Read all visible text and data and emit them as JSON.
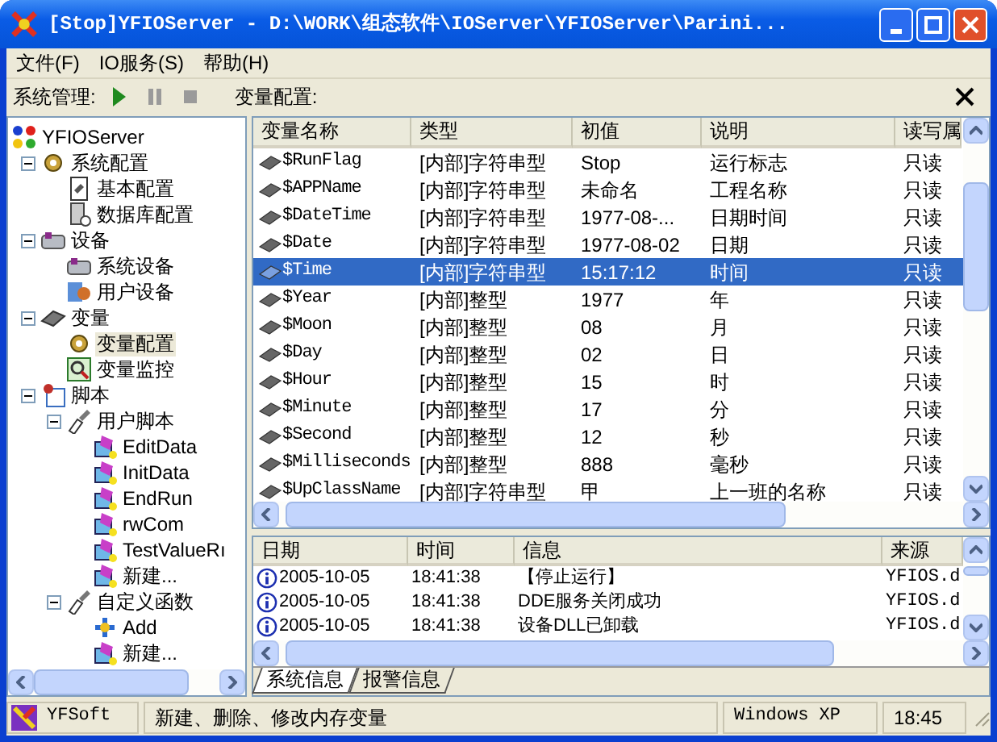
{
  "window": {
    "title": "[Stop]YFIOServer - D:\\WORK\\组态软件\\IOServer\\YFIOServer\\Parini..."
  },
  "menu": [
    "文件(F)",
    "IO服务(S)",
    "帮助(H)"
  ],
  "toolbar": {
    "label": "系统管理:",
    "buttons": [
      {
        "kind": "play",
        "disabled": false
      },
      {
        "kind": "pause",
        "disabled": true
      },
      {
        "kind": "stop",
        "disabled": true
      }
    ]
  },
  "panel_title": "变量配置:",
  "tree": {
    "label": "YFIOServer",
    "selected": false,
    "children": [
      {
        "label": "系统配置",
        "selected": false,
        "expanded": true,
        "children": [
          {
            "label": "基本配置",
            "selected": false
          },
          {
            "label": "数据库配置",
            "selected": false
          }
        ]
      },
      {
        "label": "设备",
        "selected": false,
        "expanded": true,
        "children": [
          {
            "label": "系统设备",
            "selected": false
          },
          {
            "label": "用户设备",
            "selected": false
          }
        ]
      },
      {
        "label": "变量",
        "selected": false,
        "expanded": true,
        "children": [
          {
            "label": "变量配置",
            "selected": true
          },
          {
            "label": "变量监控",
            "selected": false
          }
        ]
      },
      {
        "label": "脚本",
        "selected": false,
        "expanded": true,
        "children": [
          {
            "label": "用户脚本",
            "selected": false,
            "expanded": true,
            "children": [
              {
                "label": "EditData",
                "selected": false
              },
              {
                "label": "InitData",
                "selected": false
              },
              {
                "label": "EndRun",
                "selected": false
              },
              {
                "label": "rwCom",
                "selected": false
              },
              {
                "label": "TestValueRı",
                "selected": false
              },
              {
                "label": "新建...",
                "selected": false
              }
            ]
          },
          {
            "label": "自定义函数",
            "selected": false,
            "expanded": true,
            "children": [
              {
                "label": "Add",
                "selected": false
              },
              {
                "label": "新建...",
                "selected": false
              }
            ]
          }
        ]
      }
    ]
  },
  "table": {
    "columns": [
      "变量名称",
      "类型",
      "初值",
      "说明",
      "读写属"
    ],
    "rows": [
      {
        "cells": [
          "$RunFlag",
          "[内部]字符串型",
          "Stop",
          "运行标志",
          "只读"
        ],
        "selected": false
      },
      {
        "cells": [
          "$APPName",
          "[内部]字符串型",
          "未命名",
          "工程名称",
          "只读"
        ],
        "selected": false
      },
      {
        "cells": [
          "$DateTime",
          "[内部]字符串型",
          "1977-08-...",
          "日期时间",
          "只读"
        ],
        "selected": false
      },
      {
        "cells": [
          "$Date",
          "[内部]字符串型",
          "1977-08-02",
          "日期",
          "只读"
        ],
        "selected": false
      },
      {
        "cells": [
          "$Time",
          "[内部]字符串型",
          "15:17:12",
          "时间",
          "只读"
        ],
        "selected": true
      },
      {
        "cells": [
          "$Year",
          "[内部]整型",
          "1977",
          "年",
          "只读"
        ],
        "selected": false
      },
      {
        "cells": [
          "$Moon",
          "[内部]整型",
          "08",
          "月",
          "只读"
        ],
        "selected": false
      },
      {
        "cells": [
          "$Day",
          "[内部]整型",
          "02",
          "日",
          "只读"
        ],
        "selected": false
      },
      {
        "cells": [
          "$Hour",
          "[内部]整型",
          "15",
          "时",
          "只读"
        ],
        "selected": false
      },
      {
        "cells": [
          "$Minute",
          "[内部]整型",
          "17",
          "分",
          "只读"
        ],
        "selected": false
      },
      {
        "cells": [
          "$Second",
          "[内部]整型",
          "12",
          "秒",
          "只读"
        ],
        "selected": false
      },
      {
        "cells": [
          "$Milliseconds",
          "[内部]整型",
          "888",
          "毫秒",
          "只读"
        ],
        "selected": false
      },
      {
        "cells": [
          "$UpClassName",
          "[内部]字符串型",
          "甲",
          "上一班的名称",
          "只读"
        ],
        "selected": false
      }
    ]
  },
  "log": {
    "columns": [
      "日期",
      "时间",
      "信息",
      "来源"
    ],
    "rows": [
      {
        "kind": "info",
        "cells": [
          "2005-10-05",
          "18:41:38",
          "【停止运行】",
          "YFIOS.d"
        ]
      },
      {
        "kind": "info",
        "cells": [
          "2005-10-05",
          "18:41:38",
          "DDE服务关闭成功",
          "YFIOS.d"
        ]
      },
      {
        "kind": "info",
        "cells": [
          "2005-10-05",
          "18:41:38",
          "设备DLL已卸载",
          "YFIOS.d"
        ]
      }
    ],
    "tabs": [
      {
        "label": "系统信息",
        "selected": true
      },
      {
        "label": "报警信息",
        "selected": false
      }
    ]
  },
  "status_bar": [
    "YFSoft",
    "新建、删除、修改内存变量",
    "Windows XP",
    "18:45"
  ]
}
